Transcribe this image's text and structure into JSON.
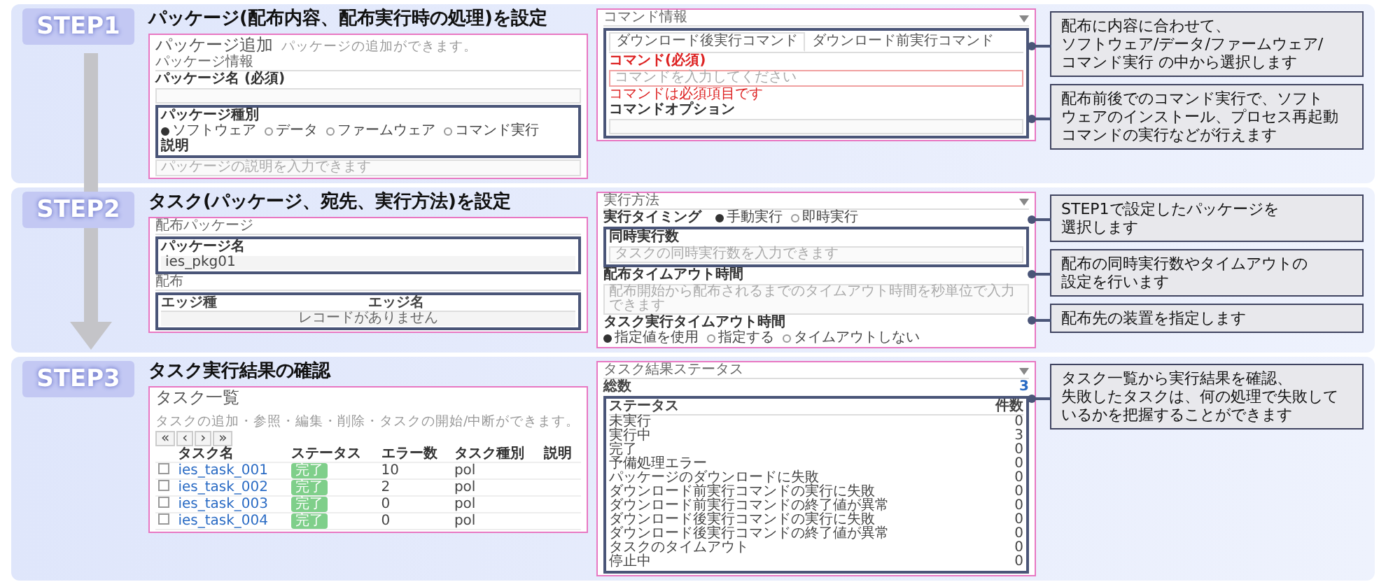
{
  "steps": [
    {
      "label": "STEP1",
      "title": "パッケージ(配布内容、配布実行時の処理)を設定",
      "screens": [
        {
          "rows": [
            {
              "kind": "heading",
              "text": "パッケージ追加",
              "sub": "パッケージの追加ができます。"
            },
            {
              "kind": "section",
              "text": "パッケージ情報"
            },
            {
              "kind": "label",
              "text": "パッケージ名 (必須)"
            },
            {
              "kind": "input"
            },
            {
              "kind": "frame",
              "rows": [
                {
                  "kind": "label",
                  "text": "パッケージ種別"
                },
                {
                  "kind": "radios",
                  "options": [
                    {
                      "label": "ソフトウェア",
                      "selected": true
                    },
                    {
                      "label": "データ",
                      "selected": false
                    },
                    {
                      "label": "ファームウェア",
                      "selected": false
                    },
                    {
                      "label": "コマンド実行",
                      "selected": false
                    }
                  ]
                },
                {
                  "kind": "label",
                  "text": "説明"
                }
              ]
            },
            {
              "kind": "input",
              "placeholder": "パッケージの説明を入力できます"
            }
          ]
        },
        {
          "rows": [
            {
              "kind": "panel_header",
              "text": "コマンド情報"
            },
            {
              "kind": "frame",
              "rows": [
                {
                  "kind": "tabs",
                  "tabs": [
                    {
                      "label": "ダウンロード後実行コマンド",
                      "selected": true
                    },
                    {
                      "label": "ダウンロード前実行コマンド",
                      "selected": false
                    }
                  ]
                },
                {
                  "kind": "label",
                  "text": "コマンド(必須)",
                  "invalid": true
                },
                {
                  "kind": "input",
                  "placeholder": "コマンドを入力してください",
                  "invalid": true
                },
                {
                  "kind": "error",
                  "text": "コマンドは必須項目です"
                },
                {
                  "kind": "label",
                  "text": "コマンドオプション"
                },
                {
                  "kind": "input"
                }
              ]
            }
          ]
        }
      ],
      "callouts": [
        [
          "配布に内容に合わせて、",
          "ソフトウェア/データ/ファームウェア/",
          "コマンド実行 の中から選択します"
        ],
        [
          "配布前後でのコマンド実行で、ソフト",
          "ウェアのインストール、プロセス再起動",
          "コマンドの実行などが行えます"
        ]
      ]
    },
    {
      "label": "STEP2",
      "title": "タスク(パッケージ、宛先、実行方法)を設定",
      "screens": [
        {
          "rows": [
            {
              "kind": "section",
              "text": "配布パッケージ"
            },
            {
              "kind": "frame",
              "rows": [
                {
                  "kind": "label",
                  "text": "パッケージ名"
                },
                {
                  "kind": "value",
                  "text": "ies_pkg01"
                }
              ]
            },
            {
              "kind": "section",
              "text": "配布"
            },
            {
              "kind": "frame",
              "rows": [
                {
                  "kind": "empty_table",
                  "columns": [
                    "エッジ種",
                    "エッジ名"
                  ],
                  "text": "レコードがありません"
                }
              ]
            }
          ]
        },
        {
          "rows": [
            {
              "kind": "panel_header",
              "text": "実行方法"
            },
            {
              "kind": "radios",
              "label": "実行タイミング",
              "options": [
                {
                  "label": "手動実行",
                  "selected": true
                },
                {
                  "label": "即時実行",
                  "selected": false
                }
              ]
            },
            {
              "kind": "frame",
              "rows": [
                {
                  "kind": "label",
                  "text": "同時実行数"
                },
                {
                  "kind": "input",
                  "placeholder": "タスクの同時実行数を入力できます"
                }
              ]
            },
            {
              "kind": "label",
              "text": "配布タイムアウト時間"
            },
            {
              "kind": "input",
              "placeholder": "配布開始から配布されるまでのタイムアウト時間を秒単位で入力できます"
            },
            {
              "kind": "label",
              "text": "タスク実行タイムアウト時間"
            },
            {
              "kind": "radios",
              "options": [
                {
                  "label": "指定値を使用",
                  "selected": true
                },
                {
                  "label": "指定する",
                  "selected": false
                },
                {
                  "label": "タイムアウトしない",
                  "selected": false
                }
              ]
            }
          ]
        }
      ],
      "callouts": [
        [
          "STEP1で設定したパッケージを",
          "選択します"
        ],
        [
          "配布の同時実行数やタイムアウトの",
          "設定を行います"
        ],
        [
          "配布先の装置を指定します"
        ]
      ]
    },
    {
      "label": "STEP3",
      "title": "タスク実行結果の確認",
      "screens": [
        {
          "rows": [
            {
              "kind": "heading",
              "text": "タスク一覧",
              "sub": "タスクの追加・参照・編集・削除・タスクの開始/中断ができます。"
            },
            {
              "kind": "pager",
              "buttons": [
                "«",
                "‹",
                "›",
                "»"
              ]
            },
            {
              "kind": "task_table",
              "columns": [
                "タスク名",
                "ステータス",
                "エラー数",
                "タスク種別",
                "説明"
              ],
              "rows": [
                {
                  "checked": false,
                  "name": "ies_task_001",
                  "status": "完了",
                  "errors": "10",
                  "type": "pol"
                },
                {
                  "checked": false,
                  "name": "ies_task_002",
                  "status": "完了",
                  "errors": "2",
                  "type": "pol"
                },
                {
                  "checked": false,
                  "name": "ies_task_003",
                  "status": "完了",
                  "errors": "0",
                  "type": "pol"
                },
                {
                  "checked": false,
                  "name": "ies_task_004",
                  "status": "完了",
                  "errors": "0",
                  "type": "pol"
                }
              ]
            }
          ]
        },
        {
          "rows": [
            {
              "kind": "panel_header",
              "text": "タスク結果ステータス"
            },
            {
              "kind": "total",
              "label": "総数",
              "value": "3"
            },
            {
              "kind": "frame",
              "rows": [
                {
                  "kind": "table",
                  "columns": [
                    "ステータス",
                    "件数"
                  ],
                  "rows": [
                    [
                      "未実行",
                      "0"
                    ],
                    [
                      "実行中",
                      "3"
                    ],
                    [
                      "完了",
                      "0"
                    ],
                    [
                      "予備処理エラー",
                      "0"
                    ],
                    [
                      "パッケージのダウンロードに失敗",
                      "0"
                    ],
                    [
                      "ダウンロード前実行コマンドの実行に失敗",
                      "0"
                    ],
                    [
                      "ダウンロード前実行コマンドの終了値が異常",
                      "0"
                    ],
                    [
                      "ダウンロード後実行コマンドの実行に失敗",
                      "0"
                    ],
                    [
                      "ダウンロード後実行コマンドの終了値が異常",
                      "0"
                    ],
                    [
                      "タスクのタイムアウト",
                      "0"
                    ],
                    [
                      "停止中",
                      "0"
                    ]
                  ]
                }
              ]
            }
          ]
        }
      ],
      "callouts": [
        [
          "タスク一覧から実行結果を確認、",
          "失敗したタスクは、何の処理で失敗して",
          "いるかを把握することができます"
        ]
      ]
    }
  ]
}
